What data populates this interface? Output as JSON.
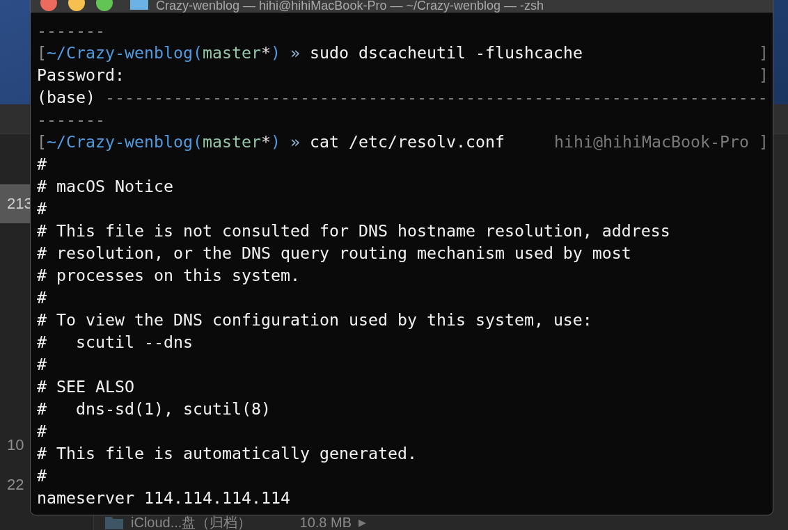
{
  "background_window": {
    "sidebar_sizes": [
      {
        "text": "213",
        "selected": true
      },
      {
        "text": "10",
        "selected": false
      },
      {
        "text": "22",
        "selected": false
      }
    ],
    "bottom_row": {
      "name": "iCloud...盘（归档）",
      "size": "10.8 MB",
      "arrow": "▶"
    }
  },
  "terminal": {
    "title": "Crazy-wenblog — hihi@hihiMacBook-Pro — ~/Crazy-wenblog — -zsh",
    "lines": [
      {
        "segments": [
          {
            "kind": "rule",
            "text": "-------"
          }
        ]
      },
      {
        "segments": [
          {
            "kind": "bracket",
            "text": "["
          },
          {
            "kind": "path",
            "text": "~/Crazy-wenblog("
          },
          {
            "kind": "branch",
            "text": "master"
          },
          {
            "kind": "dirty",
            "text": "*"
          },
          {
            "kind": "path",
            "text": ")"
          },
          {
            "kind": "arrow",
            "text": " » "
          },
          {
            "kind": "command",
            "text": "sudo dscacheutil -flushcache"
          }
        ],
        "right": "]"
      },
      {
        "segments": [
          {
            "kind": "text",
            "text": "Password:"
          }
        ],
        "right": "]"
      },
      {
        "segments": [
          {
            "kind": "text",
            "text": "(base) "
          },
          {
            "kind": "rule",
            "text": "--------------------------------------------------------------------"
          }
        ]
      },
      {
        "segments": [
          {
            "kind": "rule",
            "text": "-------"
          }
        ]
      },
      {
        "segments": [
          {
            "kind": "bracket",
            "text": "["
          },
          {
            "kind": "path",
            "text": "~/Crazy-wenblog("
          },
          {
            "kind": "branch",
            "text": "master"
          },
          {
            "kind": "dirty",
            "text": "*"
          },
          {
            "kind": "path",
            "text": ")"
          },
          {
            "kind": "arrow",
            "text": " » "
          },
          {
            "kind": "command",
            "text": "cat /etc/resolv.conf"
          }
        ],
        "right": "hihi@hihiMacBook-Pro ]"
      },
      {
        "segments": [
          {
            "kind": "text",
            "text": "#"
          }
        ]
      },
      {
        "segments": [
          {
            "kind": "text",
            "text": "# macOS Notice"
          }
        ]
      },
      {
        "segments": [
          {
            "kind": "text",
            "text": "#"
          }
        ]
      },
      {
        "segments": [
          {
            "kind": "text",
            "text": "# This file is not consulted for DNS hostname resolution, address"
          }
        ]
      },
      {
        "segments": [
          {
            "kind": "text",
            "text": "# resolution, or the DNS query routing mechanism used by most"
          }
        ]
      },
      {
        "segments": [
          {
            "kind": "text",
            "text": "# processes on this system."
          }
        ]
      },
      {
        "segments": [
          {
            "kind": "text",
            "text": "#"
          }
        ]
      },
      {
        "segments": [
          {
            "kind": "text",
            "text": "# To view the DNS configuration used by this system, use:"
          }
        ]
      },
      {
        "segments": [
          {
            "kind": "text",
            "text": "#   scutil --dns"
          }
        ]
      },
      {
        "segments": [
          {
            "kind": "text",
            "text": "#"
          }
        ]
      },
      {
        "segments": [
          {
            "kind": "text",
            "text": "# SEE ALSO"
          }
        ]
      },
      {
        "segments": [
          {
            "kind": "text",
            "text": "#   dns-sd(1), scutil(8)"
          }
        ]
      },
      {
        "segments": [
          {
            "kind": "text",
            "text": "#"
          }
        ]
      },
      {
        "segments": [
          {
            "kind": "text",
            "text": "# This file is automatically generated."
          }
        ]
      },
      {
        "segments": [
          {
            "kind": "text",
            "text": "#"
          }
        ]
      },
      {
        "segments": [
          {
            "kind": "text",
            "text": "nameserver 114.114.114.114"
          }
        ]
      }
    ]
  }
}
